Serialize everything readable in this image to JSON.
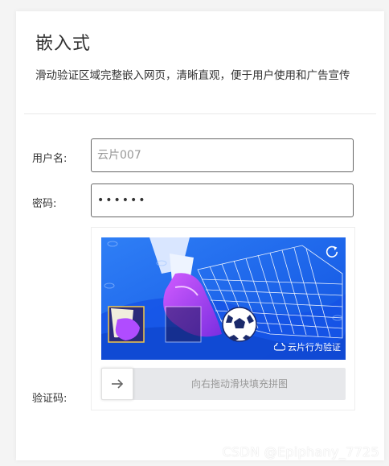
{
  "header": {
    "title": "嵌入式",
    "description": "滑动验证区域完整嵌入网页，清晰直观，便于用户使用和广告宣传"
  },
  "form": {
    "username_label": "用户名:",
    "username_placeholder": "云片007",
    "password_label": "密码:",
    "password_value": "123456",
    "captcha_label": "验证码:"
  },
  "captcha": {
    "brand_text": "云片行为验证",
    "slider_hint": "向右拖动滑块填充拼图",
    "icons": [
      "refresh-icon",
      "arrow-right-icon",
      "cloud-logo-icon"
    ]
  },
  "watermark": "CSDN @Epiphany_7725",
  "colors": {
    "captcha_background": "#1a6cf0",
    "slider_track": "#e7e8eb",
    "puzzle_accent": "#b04cff"
  }
}
